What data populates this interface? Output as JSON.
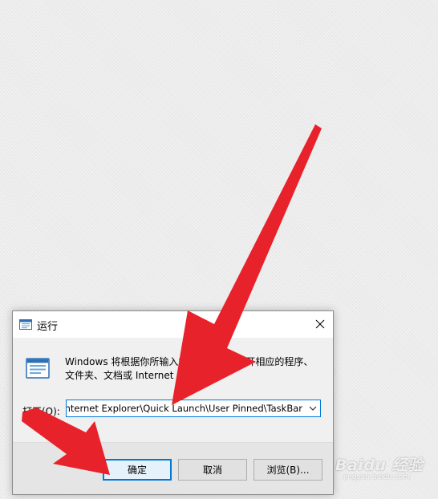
{
  "window": {
    "title": "运行",
    "description": "Windows 将根据你所输入的名称，为你打开相应的程序、\n文件夹、文档或 Internet 资源。"
  },
  "open": {
    "label": "打开(O):",
    "value": "C:\\Users\\%USERNAME%\\AppData\\Roaming\\Microsoft\\Internet Explorer\\Quick Launch\\User Pinned\\TaskBar"
  },
  "buttons": {
    "ok": "确定",
    "cancel": "取消",
    "browse": "浏览(B)..."
  },
  "annotation": {
    "arrow_color": "#e8222b"
  },
  "watermark": {
    "brand": "Baidu 经验",
    "url": "jingyan.baidu.com"
  },
  "colors": {
    "accent": "#0078d7",
    "dialog_bg": "#f0f0f0",
    "footer_bg": "#e5e5e5"
  },
  "icons": {
    "title": "run-app-icon",
    "body": "run-app-icon",
    "close": "close-icon",
    "dropdown": "chevron-down-icon"
  }
}
